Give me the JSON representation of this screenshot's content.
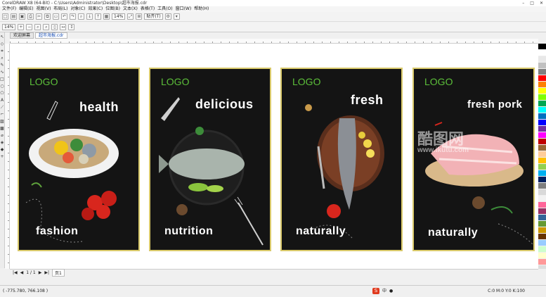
{
  "window": {
    "title": "CorelDRAW X8 (64-Bit) - C:\\Users\\Administrator\\Desktop\\超市海报.cdr"
  },
  "menu": [
    "文件(F)",
    "编辑(E)",
    "视图(V)",
    "布局(L)",
    "对象(C)",
    "效果(C)",
    "位图(B)",
    "文本(X)",
    "表格(T)",
    "工具(O)",
    "窗口(W)",
    "帮助(H)"
  ],
  "toolbar1": {
    "zoom_value": "14%",
    "snap_label": "贴齐(T)"
  },
  "toolbar2": {
    "zoom_value": "14%"
  },
  "tabs": [
    "欢迎屏幕",
    "超市海报.cdr"
  ],
  "posters": [
    {
      "logo": "LOGO",
      "headline": "health",
      "footer": "fashion"
    },
    {
      "logo": "LOGO",
      "headline": "delicious",
      "footer": "nutrition"
    },
    {
      "logo": "LOGO",
      "headline": "fresh",
      "footer": "naturally"
    },
    {
      "logo": "LOGO",
      "headline": "fresh pork",
      "footer": "naturally"
    }
  ],
  "pagebar": {
    "page_info": "1 / 1",
    "page_tab": "页1"
  },
  "status": {
    "coords": "( -775.780, 766.108 )",
    "color_info": "C:0 M:0 Y:0 K:100"
  },
  "watermark": {
    "brand": "酷图网",
    "url": "www.ikutu.com"
  },
  "palette_colors": [
    "#000000",
    "#ffffff",
    "#e8e8e8",
    "#c0c0c0",
    "#808080",
    "#ff0000",
    "#ff8000",
    "#ffff00",
    "#80ff00",
    "#00a651",
    "#00ffff",
    "#0070c0",
    "#0000ff",
    "#7030a0",
    "#ff00ff",
    "#c00000",
    "#996633",
    "#ffcc99",
    "#ffc000",
    "#92d050",
    "#00b0f0",
    "#002060",
    "#7f7f7f",
    "#d9d9d9",
    "#f2f2f2",
    "#ff6699",
    "#993366",
    "#336699",
    "#669933",
    "#cc9900",
    "#663300",
    "#99ccff",
    "#ccffcc",
    "#ffffcc",
    "#ff9999"
  ]
}
